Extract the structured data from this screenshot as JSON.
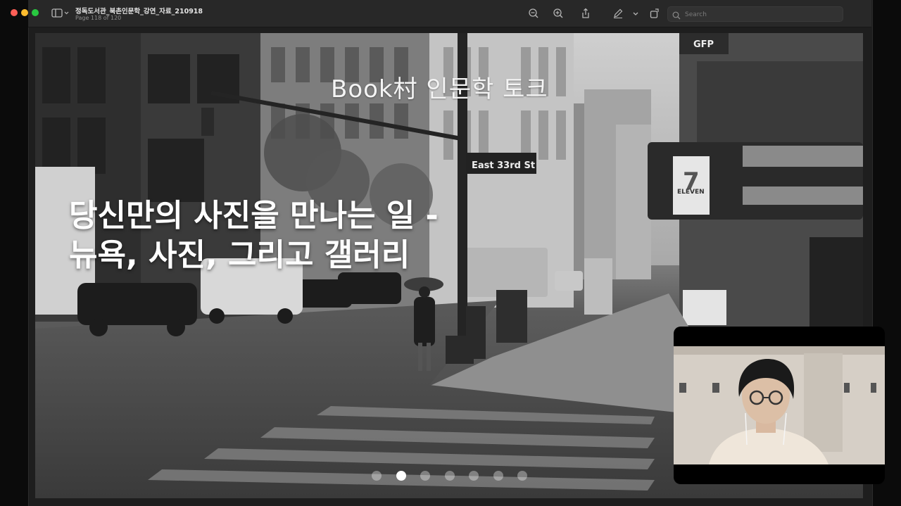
{
  "window": {
    "document_title": "정독도서관_북촌인문학_강연_자료_210918",
    "page_indicator": "Page 118 of 120"
  },
  "toolbar": {
    "icons": [
      "sidebar-icon",
      "zoom-out-icon",
      "zoom-in-icon",
      "share-icon",
      "markup-pen-icon",
      "chevron-down-icon",
      "rotate-icon",
      "annotate-icon",
      "search-icon"
    ],
    "search_placeholder": "Search"
  },
  "slide": {
    "title": "Book村 인문학 토크",
    "headline_line1": "당신만의 사진을 만나는 일 -",
    "headline_line2": "뉴욕, 사진, 그리고 갤러리",
    "street_sign": "East 33rd St",
    "store_sign": "ELEVEN",
    "store_number": "7",
    "top_sign": "GFP",
    "pagination": {
      "count": 7,
      "active_index": 1
    }
  },
  "webcam": {
    "label": "presenter video"
  }
}
